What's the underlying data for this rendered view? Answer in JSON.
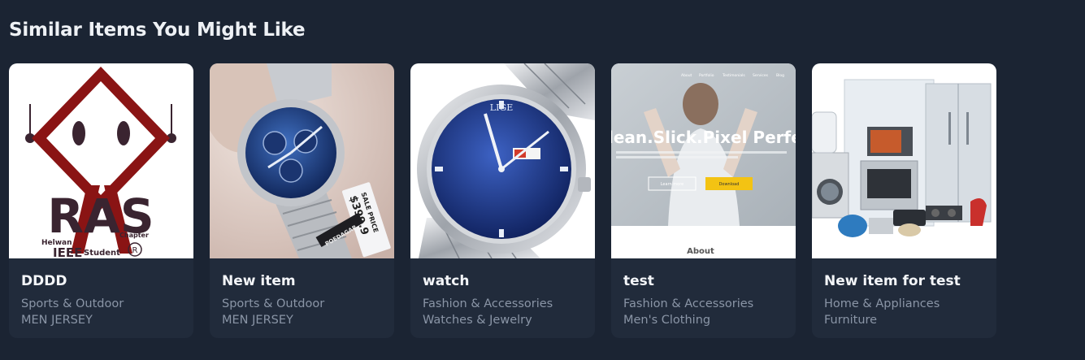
{
  "section": {
    "title": "Similar Items You Might Like"
  },
  "items": [
    {
      "name": "DDDD",
      "category": "Sports & Outdoor",
      "subcategory": "MEN JERSEY",
      "image_text": {
        "top": "RAS",
        "left": "Helwan",
        "right": "Chapter",
        "bottom_left": "IEEE",
        "bottom_right": "Student",
        "mark": "R"
      }
    },
    {
      "name": "New item",
      "category": "Sports & Outdoor",
      "subcategory": "MEN JERSEY",
      "image_text": {
        "tag_line1": "SALE PRICE",
        "tag_line2": "$399.9",
        "brand": "POEDAGAR"
      }
    },
    {
      "name": "watch",
      "category": "Fashion & Accessories",
      "subcategory": "Watches & Jewelry",
      "image_text": {
        "brand": "LIGE"
      }
    },
    {
      "name": "test",
      "category": "Fashion & Accessories",
      "subcategory": "Men's Clothing",
      "image_text": {
        "nav": [
          "About",
          "Portfolio",
          "Testimonials",
          "Services",
          "Blog"
        ],
        "headline": "lean.Slick.Pixel Perfec",
        "btn1": "Learn more",
        "btn2": "Download",
        "about": "About"
      }
    },
    {
      "name": "New item for test",
      "category": "Home & Appliances",
      "subcategory": "Furniture",
      "image_text": {}
    }
  ]
}
